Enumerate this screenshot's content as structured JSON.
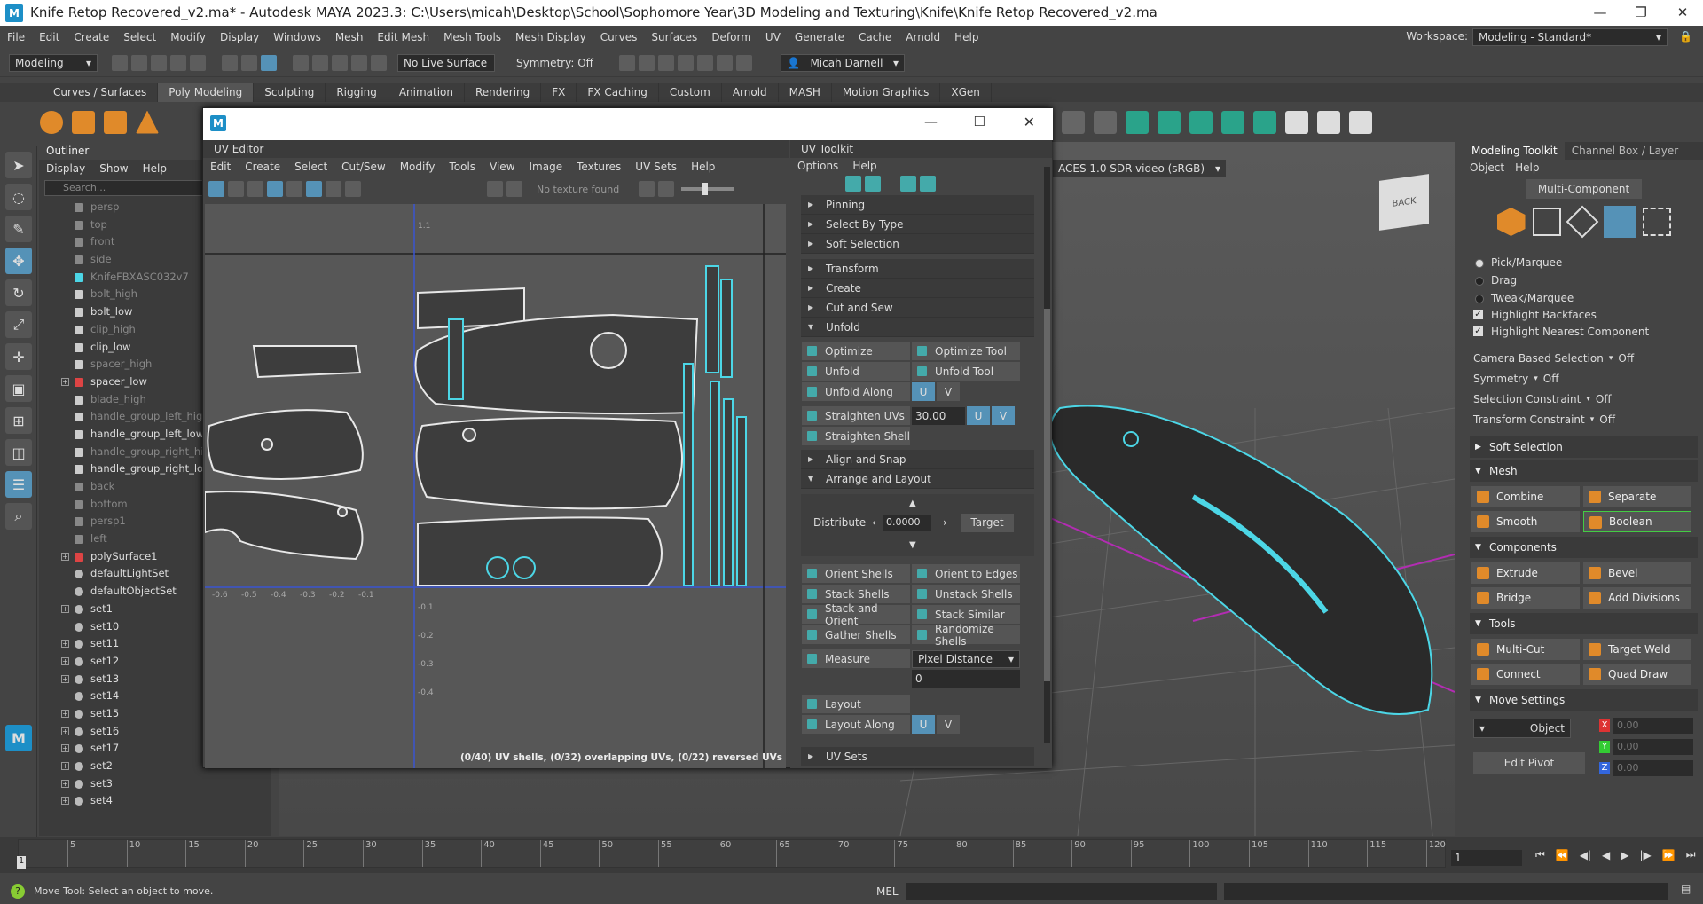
{
  "window": {
    "title": "Knife Retop Recovered_v2.ma* - Autodesk MAYA 2023.3: C:\\Users\\micah\\Desktop\\School\\Sophomore Year\\3D Modeling and Texturing\\Knife\\Knife Retop Recovered_v2.ma",
    "logo": "M"
  },
  "menubar": {
    "items": [
      "File",
      "Edit",
      "Create",
      "Select",
      "Modify",
      "Display",
      "Windows",
      "Mesh",
      "Edit Mesh",
      "Mesh Tools",
      "Mesh Display",
      "Curves",
      "Surfaces",
      "Deform",
      "UV",
      "Generate",
      "Cache",
      "Arnold",
      "Help"
    ],
    "workspace_label": "Workspace:",
    "workspace_value": "Modeling - Standard*"
  },
  "statusline": {
    "mode": "Modeling",
    "live_surface": "No Live Surface",
    "symmetry": "Symmetry: Off",
    "user": "Micah Darnell"
  },
  "shelf": {
    "tabs": [
      "Curves / Surfaces",
      "Poly Modeling",
      "Sculpting",
      "Rigging",
      "Animation",
      "Rendering",
      "FX",
      "FX Caching",
      "Custom",
      "Arnold",
      "MASH",
      "Motion Graphics",
      "XGen"
    ],
    "active": "Poly Modeling"
  },
  "outliner": {
    "title": "Outliner",
    "menu": [
      "Display",
      "Show",
      "Help"
    ],
    "search_placeholder": "Search...",
    "items": [
      {
        "label": "persp",
        "dim": true,
        "icon": "camera-icon"
      },
      {
        "label": "top",
        "dim": true,
        "icon": "camera-icon"
      },
      {
        "label": "front",
        "dim": true,
        "icon": "camera-icon"
      },
      {
        "label": "side",
        "dim": true,
        "icon": "camera-icon"
      },
      {
        "label": "KnifeFBXASC032v7",
        "dim": true,
        "icon": "joint-icon"
      },
      {
        "label": "bolt_high",
        "dim": true,
        "icon": "mesh-icon"
      },
      {
        "label": "bolt_low",
        "dim": false,
        "icon": "mesh-icon"
      },
      {
        "label": "clip_high",
        "dim": true,
        "icon": "mesh-icon"
      },
      {
        "label": "clip_low",
        "dim": false,
        "icon": "mesh-icon"
      },
      {
        "label": "spacer_high",
        "dim": true,
        "icon": "mesh-icon"
      },
      {
        "label": "spacer_low",
        "dim": false,
        "icon": "group-icon",
        "expand": true
      },
      {
        "label": "blade_high",
        "dim": true,
        "icon": "mesh-icon"
      },
      {
        "label": "handle_group_left_high",
        "dim": true,
        "icon": "mesh-icon"
      },
      {
        "label": "handle_group_left_low",
        "dim": false,
        "icon": "mesh-icon"
      },
      {
        "label": "handle_group_right_high",
        "dim": true,
        "icon": "mesh-icon"
      },
      {
        "label": "handle_group_right_low",
        "dim": false,
        "icon": "mesh-icon"
      },
      {
        "label": "back",
        "dim": true,
        "icon": "camera-icon"
      },
      {
        "label": "bottom",
        "dim": true,
        "icon": "camera-icon"
      },
      {
        "label": "persp1",
        "dim": true,
        "icon": "camera-icon"
      },
      {
        "label": "left",
        "dim": true,
        "icon": "camera-icon"
      },
      {
        "label": "polySurface1",
        "dim": false,
        "icon": "group-icon",
        "expand": true
      },
      {
        "label": "defaultLightSet",
        "dim": false,
        "icon": "set-icon"
      },
      {
        "label": "defaultObjectSet",
        "dim": false,
        "icon": "set-icon"
      },
      {
        "label": "set1",
        "dim": false,
        "icon": "set-icon",
        "expand": true
      },
      {
        "label": "set10",
        "dim": false,
        "icon": "set-icon"
      },
      {
        "label": "set11",
        "dim": false,
        "icon": "set-icon",
        "expand": true
      },
      {
        "label": "set12",
        "dim": false,
        "icon": "set-icon",
        "expand": true
      },
      {
        "label": "set13",
        "dim": false,
        "icon": "set-icon",
        "expand": true
      },
      {
        "label": "set14",
        "dim": false,
        "icon": "set-icon"
      },
      {
        "label": "set15",
        "dim": false,
        "icon": "set-icon",
        "expand": true
      },
      {
        "label": "set16",
        "dim": false,
        "icon": "set-icon",
        "expand": true
      },
      {
        "label": "set17",
        "dim": false,
        "icon": "set-icon",
        "expand": true
      },
      {
        "label": "set2",
        "dim": false,
        "icon": "set-icon",
        "expand": true
      },
      {
        "label": "set3",
        "dim": false,
        "icon": "set-icon",
        "expand": true
      },
      {
        "label": "set4",
        "dim": false,
        "icon": "set-icon",
        "expand": true
      }
    ]
  },
  "viewport": {
    "color_space": "ACES 1.0 SDR-video (sRGB)",
    "viewcube": "BACK"
  },
  "uv_editor": {
    "title": "UV Editor",
    "menu": [
      "Edit",
      "Create",
      "Select",
      "Cut/Sew",
      "Modify",
      "Tools",
      "View",
      "Image",
      "Textures",
      "UV Sets",
      "Help"
    ],
    "no_texture": "No texture found",
    "status": "(0/40) UV shells, (0/32) overlapping UVs, (0/22) reversed UVs",
    "x_ticks": [
      "-0.6",
      "-0.5",
      "-0.4",
      "-0.3",
      "-0.2",
      "-0.1"
    ],
    "y_ticks": [
      "1.1",
      "-0.1",
      "-0.2",
      "-0.3",
      "-0.4"
    ]
  },
  "uv_toolkit": {
    "title": "UV Toolkit",
    "menu": [
      "Options",
      "Help"
    ],
    "sections_top": [
      "Pinning",
      "Select By Type",
      "Soft Selection"
    ],
    "sections_mid": [
      "Transform",
      "Create",
      "Cut and Sew"
    ],
    "unfold": "Unfold",
    "unfold_buttons": [
      [
        "Optimize",
        "Optimize Tool"
      ],
      [
        "Unfold",
        "Unfold Tool"
      ]
    ],
    "unfold_along": "Unfold Along",
    "straighten_uvs": "Straighten UVs",
    "straighten_value": "30.00",
    "straighten_shell": "Straighten Shell",
    "align_snap": "Align and Snap",
    "arrange_layout": "Arrange and Layout",
    "distribute": "Distribute",
    "distribute_value": "0.0000",
    "target": "Target",
    "layout_buttons": [
      [
        "Orient Shells",
        "Orient to Edges"
      ],
      [
        "Stack Shells",
        "Unstack Shells"
      ],
      [
        "Stack and Orient",
        "Stack Similar"
      ],
      [
        "Gather Shells",
        "Randomize Shells"
      ]
    ],
    "measure": "Measure",
    "measure_mode": "Pixel Distance",
    "measure_value": "0",
    "layout": "Layout",
    "layout_along": "Layout Along",
    "uv_sets": "UV Sets",
    "u": "U",
    "v": "V"
  },
  "modeling_toolkit": {
    "tabs": [
      "Modeling Toolkit",
      "Channel Box / Layer"
    ],
    "menu": [
      "Object",
      "Help"
    ],
    "multi_component": "Multi-Component",
    "radios": [
      {
        "label": "Pick/Marquee",
        "on": true
      },
      {
        "label": "Drag",
        "on": false
      },
      {
        "label": "Tweak/Marquee",
        "on": false
      }
    ],
    "checks": [
      "Highlight Backfaces",
      "Highlight Nearest Component"
    ],
    "options": [
      {
        "label": "Camera Based Selection",
        "value": "Off"
      },
      {
        "label": "Symmetry",
        "value": "Off"
      },
      {
        "label": "Selection Constraint",
        "value": "Off"
      },
      {
        "label": "Transform Constraint",
        "value": "Off"
      }
    ],
    "soft_selection": "Soft Selection",
    "mesh": "Mesh",
    "mesh_buttons": [
      [
        "Combine",
        "Separate"
      ],
      [
        "Smooth",
        "Boolean"
      ]
    ],
    "components": "Components",
    "comp_buttons": [
      [
        "Extrude",
        "Bevel"
      ],
      [
        "Bridge",
        "Add Divisions"
      ]
    ],
    "tools": "Tools",
    "tool_buttons": [
      [
        "Multi-Cut",
        "Target Weld"
      ],
      [
        "Connect",
        "Quad Draw"
      ]
    ],
    "move_settings": "Move Settings",
    "object": "Object",
    "xyz": [
      {
        "axis": "X",
        "value": "0.00",
        "color": "#d33"
      },
      {
        "axis": "Y",
        "value": "0.00",
        "color": "#3c3"
      },
      {
        "axis": "Z",
        "value": "0.00",
        "color": "#36d"
      }
    ],
    "edit_pivot": "Edit Pivot"
  },
  "timeline": {
    "ticks": [
      "5",
      "10",
      "15",
      "20",
      "25",
      "30",
      "35",
      "40",
      "45",
      "50",
      "55",
      "60",
      "65",
      "70",
      "75",
      "80",
      "85",
      "90",
      "95",
      "100",
      "105",
      "110",
      "115",
      "120"
    ],
    "current": "1",
    "start": "1"
  },
  "cmdline": {
    "help": "Move Tool: Select an object to move.",
    "lang": "MEL"
  }
}
